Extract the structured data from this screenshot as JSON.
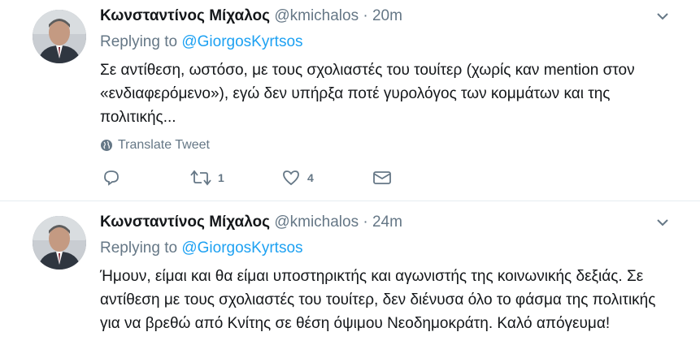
{
  "tweets": [
    {
      "name": "Κωνσταντίνος Μίχαλος",
      "handle": "@kmichalos",
      "separator": "·",
      "time": "20m",
      "replying_label": "Replying to",
      "replying_to": "@GiorgosKyrtsos",
      "text": "Σε αντίθεση, ωστόσο, με τους σχολιαστές του τουίτερ (χωρίς καν mention στον «ενδιαφερόμενο»), εγώ δεν υπήρξα ποτέ γυρολόγος των κομμάτων και της πολιτικής...",
      "translate_label": "Translate Tweet",
      "retweet_count": "1",
      "like_count": "4"
    },
    {
      "name": "Κωνσταντίνος Μίχαλος",
      "handle": "@kmichalos",
      "separator": "·",
      "time": "24m",
      "replying_label": "Replying to",
      "replying_to": "@GiorgosKyrtsos",
      "text": "Ήμουν, είμαι και θα είμαι υποστηρικτής και αγωνιστής της κοινωνικής δεξιάς. Σε αντίθεση με τους σχολιαστές του τουίτερ, δεν διένυσα όλο το φάσμα της πολιτικής για να βρεθώ από Κνίτης σε θέση όψιμου Νεοδημοκράτη. Καλό απόγευμα!"
    }
  ],
  "colors": {
    "accent": "#1da1f2",
    "muted": "#657786",
    "text": "#14171a",
    "divider": "#e6ecf0"
  },
  "icons": [
    "avatar",
    "chevron-down-icon",
    "globe-icon",
    "reply-icon",
    "retweet-icon",
    "like-icon",
    "message-icon"
  ]
}
